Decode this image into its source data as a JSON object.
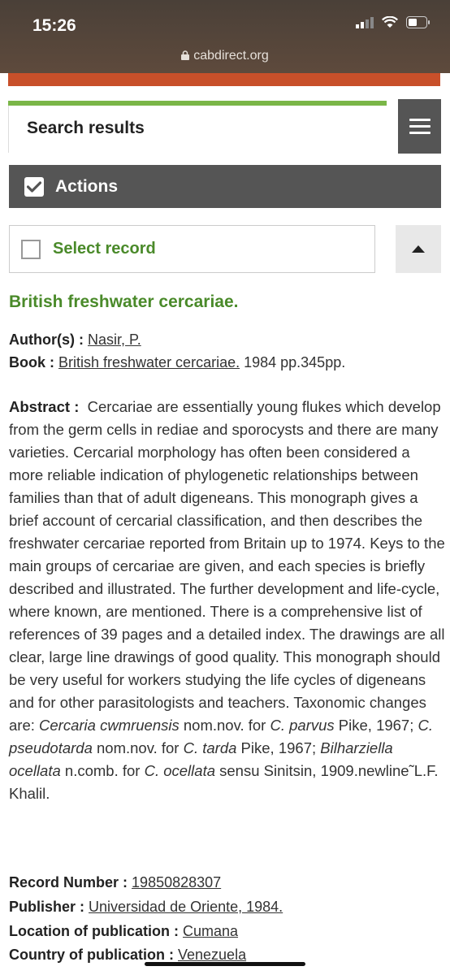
{
  "status_bar": {
    "time": "15:26",
    "url": "cabdirect.org"
  },
  "header": {
    "title": "Search results"
  },
  "actions": {
    "label": "Actions"
  },
  "select": {
    "label": "Select record"
  },
  "record": {
    "title": "British freshwater cercariae.",
    "author_label": "Author(s) :",
    "author": "Nasir, P.",
    "book_label": "Book :",
    "book_link": "British freshwater cercariae.",
    "book_rest": " 1984 pp.345pp.",
    "abstract_label": "Abstract :",
    "abstract_1": "Cercariae are essentially young flukes which develop from the germ cells in rediae and sporocysts and there are many varieties. Cercarial morphology has often been considered a more reliable indication of phylogenetic relationships between families than that of adult digeneans. This monograph gives a brief account of cercarial classification, and then describes the freshwater cercariae reported from Britain up to 1974. Keys to the main groups of cercariae are given, and each species is briefly described and illustrated. The further development and life-cycle, where known, are mentioned. There is a comprehensive list of references of 39 pages and a detailed index. The drawings are all clear, large line drawings of good quality. This monograph should be very useful for workers studying the life cycles of digeneans and for other parasitologists and teachers. Taxonomic changes are: ",
    "abstract_i1": "Cercaria cwmruensis",
    "abstract_2": " nom.nov. for ",
    "abstract_i2": "C. parvus",
    "abstract_3": " Pike, 1967; ",
    "abstract_i3": "C. pseudotarda",
    "abstract_4": " nom.nov. for ",
    "abstract_i4": "C. tarda",
    "abstract_5": " Pike, 1967; ",
    "abstract_i5": "Bilharziella ocellata",
    "abstract_6": " n.comb. for ",
    "abstract_i6": "C. ocellata",
    "abstract_7": " sensu Sinitsin, 1909.newline˜L.F. Khalil.",
    "record_number_label": "Record Number :",
    "record_number": "19850828307",
    "publisher_label": "Publisher :",
    "publisher": "Universidad de Oriente, 1984.",
    "location_label": "Location of publication :",
    "location": "Cumana",
    "country_label": "Country of publication :",
    "country": "Venezuela"
  }
}
